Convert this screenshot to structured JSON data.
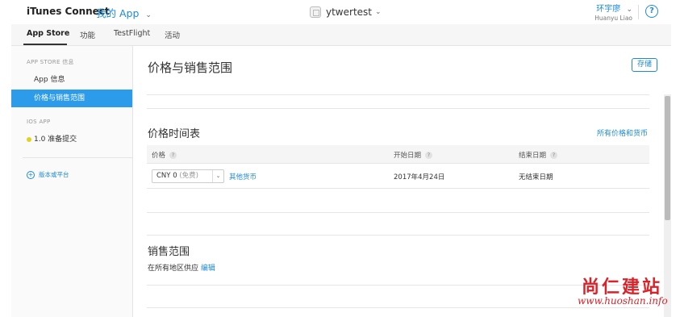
{
  "header": {
    "brand": "iTunes Connect",
    "my_app": "我的 App",
    "app_name": "ytwertest",
    "user_name": "环宇廖",
    "user_sub": "Huanyu Liao",
    "help": "?"
  },
  "tabs": [
    {
      "label": "App Store",
      "active": true
    },
    {
      "label": "功能",
      "active": false
    },
    {
      "label": "TestFlight",
      "active": false
    },
    {
      "label": "活动",
      "active": false
    }
  ],
  "sidebar": {
    "section_store": "APP STORE 信息",
    "items": [
      {
        "label": "App 信息",
        "active": false
      },
      {
        "label": "价格与销售范围",
        "active": true
      }
    ],
    "section_ios": "IOS APP",
    "version": "1.0 准备提交",
    "version_status_color": "#e2d21a",
    "add_platform": "版本或平台"
  },
  "main": {
    "title": "价格与销售范围",
    "save": "存储",
    "price_schedule": {
      "title": "价格时间表",
      "all_link": "所有价格和货币",
      "columns": [
        "价格",
        "开始日期",
        "结束日期"
      ],
      "row": {
        "price_value": "CNY 0",
        "price_note": "(免费)",
        "other_currency": "其他货币",
        "start": "2017年4月24日",
        "end": "无结束日期"
      }
    },
    "availability": {
      "title": "销售范围",
      "text": "在所有地区供应",
      "edit": "编辑"
    }
  },
  "watermark": {
    "cn": "尚仁建站",
    "en": "www.huoshan.info"
  },
  "colors": {
    "accent": "#1e8ad6",
    "active_sidebar": "#2c9bea",
    "watermark": "#d8232a"
  }
}
